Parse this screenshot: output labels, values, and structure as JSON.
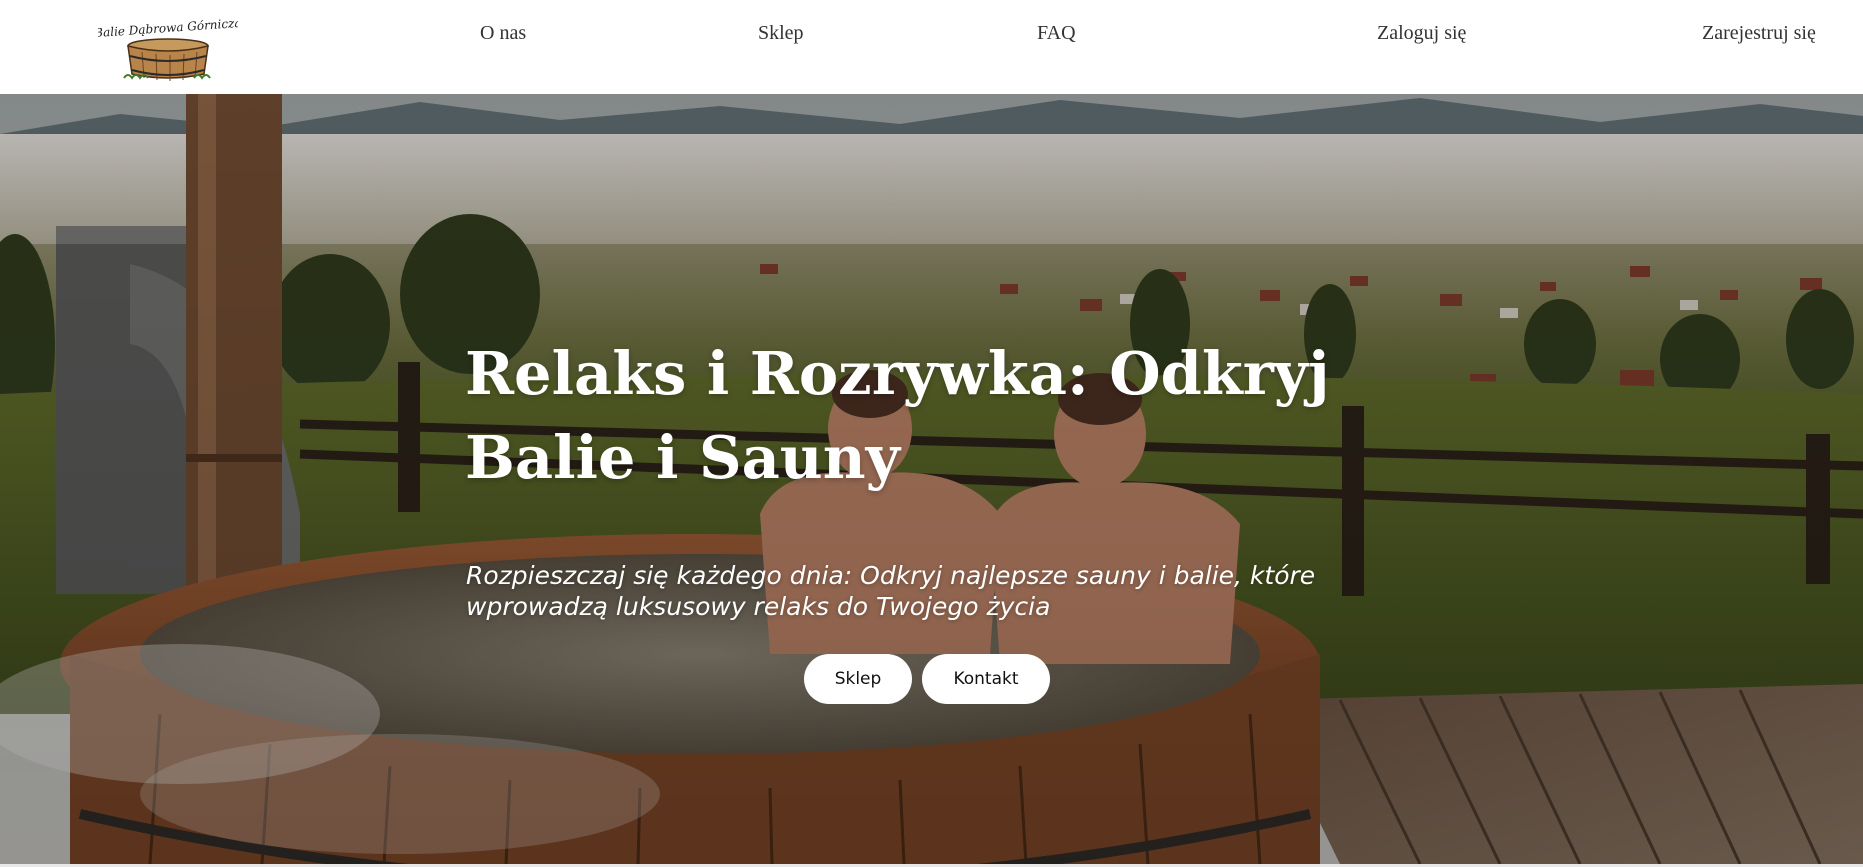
{
  "logo": {
    "text": "Balie Dąbrowa Górnicza",
    "icon": "wooden-tub-logo"
  },
  "nav": {
    "about": "O nas",
    "shop": "Sklep",
    "faq": "FAQ",
    "login": "Zaloguj się",
    "register": "Zarejestruj się"
  },
  "hero": {
    "title": "Relaks i Rozrywka: Odkryj Balie i Sauny",
    "subtitle": "Rozpieszczaj się każdego dnia: Odkryj najlepsze sauny i balie, które wprowadzą luksusowy relaks do Twojego życia",
    "buttons": {
      "shop": "Sklep",
      "contact": "Kontakt"
    },
    "image": "two-men-in-wooden-hot-tub-mountain-village-view"
  },
  "colors": {
    "nav_text": "#333333",
    "hero_text": "#ffffff",
    "button_bg": "#ffffff",
    "button_text": "#111111"
  }
}
